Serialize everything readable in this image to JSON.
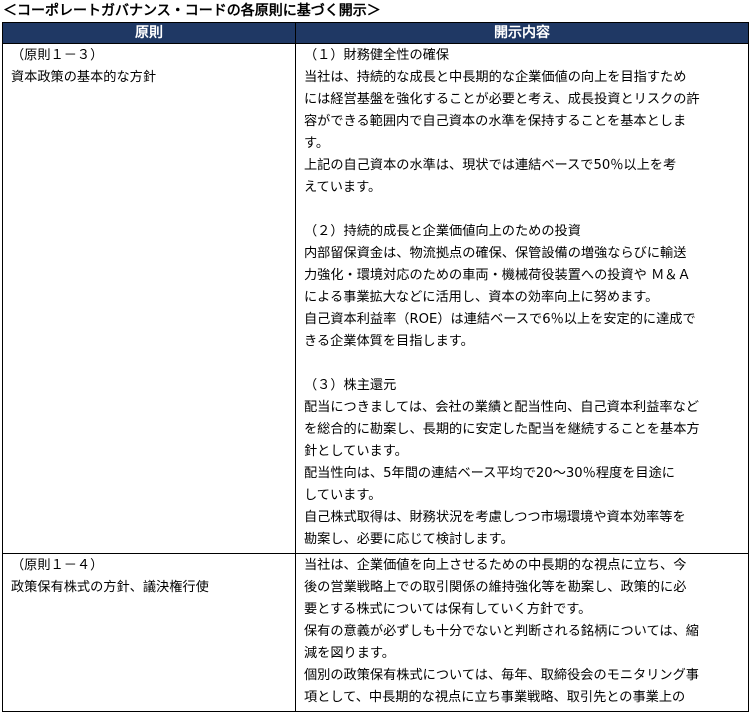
{
  "heading": "＜コーポレートガバナンス・コードの各原則に基づく開示＞",
  "table": {
    "header_principle": "原則",
    "header_disclosure": "開示内容",
    "rows": [
      {
        "principle_number": "（原則１－３）",
        "principle_title": "資本政策の基本的な方針",
        "sections": [
          {
            "title": "（１）財務健全性の確保",
            "lines": [
              "当社は、持続的な成長と中長期的な企業価値の向上を目指すため",
              "には経営基盤を強化することが必要と考え、成長投資とリスクの許",
              "容ができる範囲内で自己資本の水準を保持することを基本としま",
              "す。",
              "上記の自己資本の水準は、現状では連結ベースで50％以上を考",
              "えています。"
            ]
          },
          {
            "title": "（２）持続的成長と企業価値向上のための投資",
            "lines": [
              "内部留保資金は、物流拠点の確保、保管設備の増強ならびに輸送",
              "力強化・環境対応のための車両・機械荷役装置への投資や Ｍ＆Ａ",
              "による事業拡大などに活用し、資本の効率向上に努めます。",
              "自己資本利益率（ROE）は連結ベースで6％以上を安定的に達成で",
              "きる企業体質を目指します。"
            ]
          },
          {
            "title": "（３）株主還元",
            "lines": [
              "配当につきましては、会社の業績と配当性向、自己資本利益率など",
              "を総合的に勘案し、長期的に安定した配当を継続することを基本方",
              "針としています。",
              "配当性向は、5年間の連結ベース平均で20～30％程度を目途に",
              "しています。",
              "自己株式取得は、財務状況を考慮しつつ市場環境や資本効率等を",
              "勘案し、必要に応じて検討します。"
            ]
          }
        ]
      },
      {
        "principle_number": "（原則１－４）",
        "principle_title": "政策保有株式の方針、議決権行使",
        "lines": [
          "当社は、企業価値を向上させるための中長期的な視点に立ち、今",
          "後の営業戦略上での取引関係の維持強化等を勘案し、政策的に必",
          "要とする株式については保有していく方針です。",
          "保有の意義が必ずしも十分でないと判断される銘柄については、縮",
          "減を図ります。",
          "個別の政策保有株式については、毎年、取締役会のモニタリング事",
          "項として、中長期的な視点に立ち事業戦略、取引先との事業上の"
        ]
      }
    ]
  }
}
